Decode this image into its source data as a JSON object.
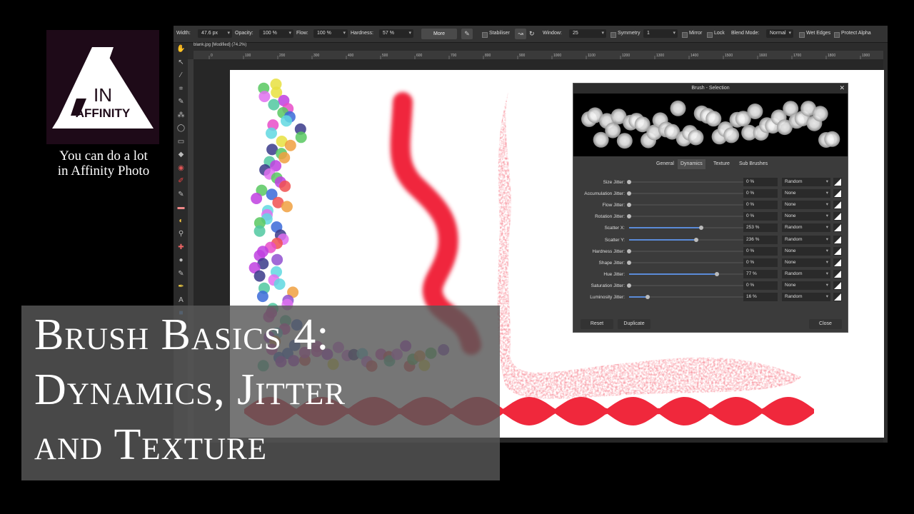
{
  "brand": {
    "logo_line1": "IN",
    "logo_line2": "AFFINITY",
    "caption_line1": "You can do a lot",
    "caption_line2": "in Affinity Photo"
  },
  "video_title": {
    "line1": "Brush Basics 4:",
    "line2": "Dynamics, Jitter",
    "line3": "and Texture"
  },
  "context_toolbar": {
    "width_label": "Width:",
    "width_value": "47.6 px",
    "opacity_label": "Opacity:",
    "opacity_value": "100 %",
    "flow_label": "Flow:",
    "flow_value": "100 %",
    "hardness_label": "Hardness:",
    "hardness_value": "57 %",
    "more_label": "More",
    "stabiliser_label": "Stabiliser",
    "window_label": "Window:",
    "window_value": "25",
    "symmetry_label": "Symmetry",
    "symmetry_value": "1",
    "mirror_label": "Mirror",
    "lock_label": "Lock",
    "blend_mode_label": "Blend Mode:",
    "blend_mode_value": "Normal",
    "wet_edges_label": "Wet Edges",
    "protect_alpha_label": "Protect Alpha"
  },
  "document_tab": "blank.jpg [Modified] (74.2%)",
  "ruler_ticks": [
    "0",
    "100",
    "200",
    "300",
    "400",
    "500",
    "600",
    "700",
    "800",
    "900",
    "1000",
    "1100",
    "1200",
    "1300",
    "1400",
    "1500",
    "1600",
    "1700",
    "1800",
    "1900"
  ],
  "tools": [
    "hand-tool",
    "move-tool",
    "color-picker-tool",
    "crop-tool",
    "selection-brush-tool",
    "flood-select-tool",
    "freehand-select-tool",
    "marquee-tool",
    "fill-tool",
    "color-wheel",
    "paint-brush-tool",
    "pixel-tool",
    "erase-tool",
    "dodge-tool",
    "clone-tool",
    "healing-tool",
    "blur-tool",
    "burn-tool",
    "pen-tool",
    "text-tool",
    "shape-tool"
  ],
  "brush_dialog": {
    "title": "Brush - Selection",
    "tabs": [
      "General",
      "Dynamics",
      "Texture",
      "Sub Brushes"
    ],
    "active_tab": "Dynamics",
    "rows": [
      {
        "label": "Size Jitter:",
        "value": "0 %",
        "mode": "Random",
        "fraction": 0
      },
      {
        "label": "Accumulation Jitter:",
        "value": "0 %",
        "mode": "None",
        "fraction": 0
      },
      {
        "label": "Flow Jitter:",
        "value": "0 %",
        "mode": "None",
        "fraction": 0
      },
      {
        "label": "Rotation Jitter:",
        "value": "0 %",
        "mode": "None",
        "fraction": 0
      },
      {
        "label": "Scatter X:",
        "value": "253 %",
        "mode": "Random",
        "fraction": 0.63
      },
      {
        "label": "Scatter Y:",
        "value": "236 %",
        "mode": "Random",
        "fraction": 0.59
      },
      {
        "label": "Hardness Jitter:",
        "value": "0 %",
        "mode": "None",
        "fraction": 0
      },
      {
        "label": "Shape Jitter:",
        "value": "0 %",
        "mode": "None",
        "fraction": 0
      },
      {
        "label": "Hue Jitter:",
        "value": "77 %",
        "mode": "Random",
        "fraction": 0.77
      },
      {
        "label": "Saturation Jitter:",
        "value": "0 %",
        "mode": "None",
        "fraction": 0
      },
      {
        "label": "Luminosity Jitter:",
        "value": "16 %",
        "mode": "Random",
        "fraction": 0.16
      }
    ],
    "reset_label": "Reset",
    "duplicate_label": "Duplicate",
    "close_label": "Close"
  },
  "colors": {
    "logo_bg": "#1e0a18",
    "stroke_red": "#f0283c",
    "slider_fill": "#5b8bd8"
  }
}
